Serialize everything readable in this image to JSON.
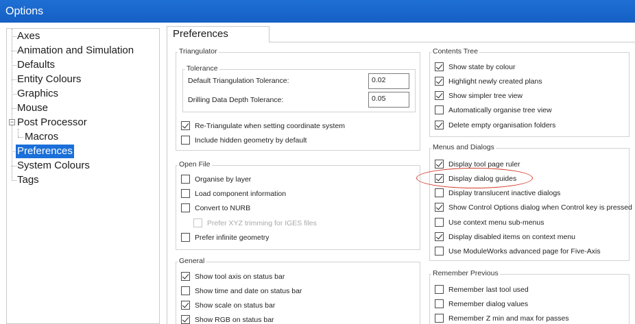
{
  "window": {
    "title": "Options"
  },
  "tree": {
    "items": [
      {
        "label": "Axes"
      },
      {
        "label": "Animation and Simulation"
      },
      {
        "label": "Defaults"
      },
      {
        "label": "Entity Colours"
      },
      {
        "label": "Graphics"
      },
      {
        "label": "Mouse"
      },
      {
        "label": "Post Processor"
      },
      {
        "label": "Macros"
      },
      {
        "label": "Preferences"
      },
      {
        "label": "System Colours"
      },
      {
        "label": "Tags"
      }
    ]
  },
  "tab": {
    "label": "Preferences"
  },
  "triangulator": {
    "title": "Triangulator",
    "tolerance": {
      "title": "Tolerance",
      "default_label": "Default Triangulation Tolerance:",
      "default_value": "0.02",
      "drilling_label": "Drilling Data Depth Tolerance:",
      "drilling_value": "0.05"
    },
    "options": [
      {
        "label": "Re-Triangulate when setting coordinate system",
        "checked": true
      },
      {
        "label": "Include hidden geometry by default",
        "checked": false
      }
    ]
  },
  "open_file": {
    "title": "Open File",
    "options": [
      {
        "label": "Organise by layer",
        "checked": false
      },
      {
        "label": "Load component information",
        "checked": false
      },
      {
        "label": "Convert to NURB",
        "checked": false
      },
      {
        "label": "Prefer XYZ trimming for IGES files",
        "checked": false,
        "disabled": true
      },
      {
        "label": "Prefer infinite geometry",
        "checked": false
      }
    ]
  },
  "general": {
    "title": "General",
    "options": [
      {
        "label": "Show tool axis on status bar",
        "checked": true
      },
      {
        "label": "Show time and date on status bar",
        "checked": false
      },
      {
        "label": "Show scale on status bar",
        "checked": true
      },
      {
        "label": "Show RGB on status bar",
        "checked": true
      }
    ]
  },
  "contents_tree": {
    "title": "Contents Tree",
    "options": [
      {
        "label": "Show state by colour",
        "checked": true
      },
      {
        "label": "Highlight newly created plans",
        "checked": true
      },
      {
        "label": "Show simpler tree view",
        "checked": true
      },
      {
        "label": "Automatically organise tree view",
        "checked": false
      },
      {
        "label": "Delete empty organisation folders",
        "checked": true
      }
    ]
  },
  "menus_dialogs": {
    "title": "Menus and Dialogs",
    "options": [
      {
        "label": "Display tool page ruler",
        "checked": true
      },
      {
        "label": "Display dialog guides",
        "checked": true
      },
      {
        "label": "Display translucent inactive dialogs",
        "checked": false
      },
      {
        "label": "Show Control Options dialog when Control key is pressed",
        "checked": true
      },
      {
        "label": "Use context menu sub-menus",
        "checked": false
      },
      {
        "label": "Display disabled items on context menu",
        "checked": true
      },
      {
        "label": "Use ModuleWorks advanced page for Five-Axis",
        "checked": false
      }
    ]
  },
  "remember_previous": {
    "title": "Remember Previous",
    "options": [
      {
        "label": "Remember last tool used",
        "checked": false
      },
      {
        "label": "Remember dialog values",
        "checked": false
      },
      {
        "label": "Remember Z min and max for passes",
        "checked": false
      }
    ]
  },
  "colors": {
    "titlebar": "#1560c5",
    "selection": "#1a6fd8",
    "annotation": "#d23a2a"
  }
}
